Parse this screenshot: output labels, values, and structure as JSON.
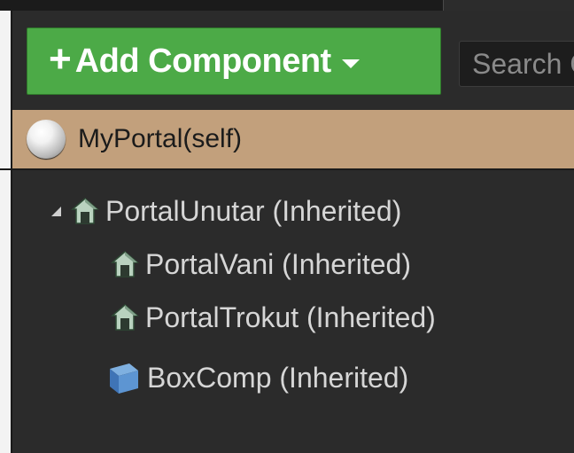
{
  "toolbar": {
    "add_component_plus": "+",
    "add_component_label": "Add Component",
    "search_placeholder": "Search Components"
  },
  "self_row": {
    "label": "MyPortal(self)"
  },
  "components": [
    {
      "label": "PortalUnutar (Inherited)",
      "icon": "scene-component-icon",
      "expanded": true
    },
    {
      "label": "PortalVani (Inherited)",
      "icon": "scene-component-icon"
    },
    {
      "label": "PortalTrokut (Inherited)",
      "icon": "scene-component-icon"
    },
    {
      "label": "BoxComp (Inherited)",
      "icon": "box-collision-icon"
    }
  ],
  "colors": {
    "add_button": "#4caa47",
    "self_row": "#c2a07c",
    "panel_bg": "#2b2b2b",
    "text": "#d6d6d6"
  }
}
